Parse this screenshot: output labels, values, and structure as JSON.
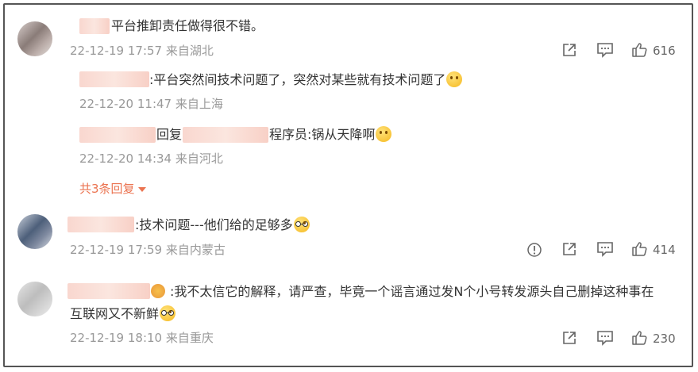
{
  "comments": [
    {
      "text": "平台推卸责任做得很不错。",
      "time": "22-12-19 17:57",
      "location": "来自湖北",
      "likes": "616",
      "replies": [
        {
          "text": ":平台突然间技术问题了，突然对某些就有技术问题了",
          "time": "22-12-20 11:47",
          "location": "来自上海"
        },
        {
          "reply_word": "回复",
          "text": "程序员:锅从天降啊",
          "time": "22-12-20 14:34",
          "location": "来自河北"
        }
      ],
      "more_replies": "共3条回复"
    },
    {
      "text": ":技术问题---他们给的足够多",
      "time": "22-12-19 17:59",
      "location": "来自内蒙古",
      "likes": "414"
    },
    {
      "text_line1": ":我不太信它的解释，请严查，毕竟一个谣言通过发N个小号转发源头自己删掉这种事在",
      "text_line2": "互联网又不新鲜",
      "time": "22-12-19 18:10",
      "location": "来自重庆",
      "likes": "230"
    }
  ],
  "icons": {
    "share": "share-icon",
    "comment": "comment-icon",
    "like": "thumbs-up-icon",
    "report": "report-icon"
  }
}
